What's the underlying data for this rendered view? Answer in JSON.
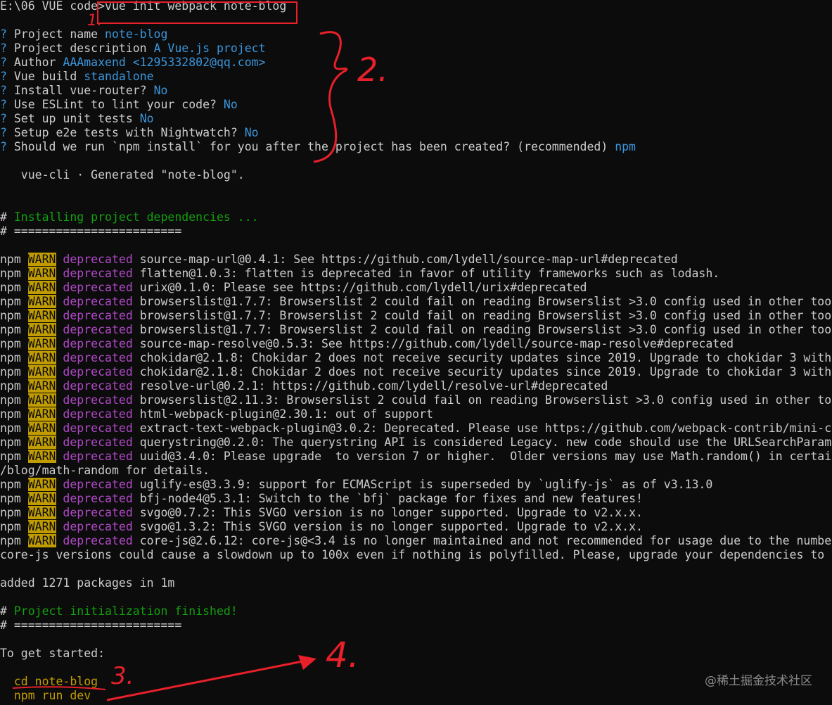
{
  "terminal": {
    "command_line": {
      "prompt": "E:\\06 VUE code>",
      "command": "vue init webpack note-blog"
    },
    "questions": [
      {
        "q": "Project name ",
        "a": "note-blog"
      },
      {
        "q": "Project description ",
        "a": "A Vue.js project"
      },
      {
        "q": "Author ",
        "a": "AAAmaxend <1295332802@qq.com>"
      },
      {
        "q": "Vue build ",
        "a": "standalone"
      },
      {
        "q": "Install vue-router? ",
        "a": "No"
      },
      {
        "q": "Use ESLint to lint your code? ",
        "a": "No"
      },
      {
        "q": "Set up unit tests ",
        "a": "No"
      },
      {
        "q": "Setup e2e tests with Nightwatch? ",
        "a": "No"
      },
      {
        "q": "Should we run `npm install` for you after the project has been created? (recommended) ",
        "a": "npm"
      }
    ],
    "question_mark": "?",
    "generated": "   vue-cli · Generated \"note-blog\".",
    "install_header": "# Installing project dependencies ...",
    "separator": "# ========================",
    "npm_label": "npm ",
    "warn_label": "WARN",
    "deprecated_label": " deprecated ",
    "warnings": [
      "source-map-url@0.4.1: See https://github.com/lydell/source-map-url#deprecated",
      "flatten@1.0.3: flatten is deprecated in favor of utility frameworks such as lodash.",
      "urix@0.1.0: Please see https://github.com/lydell/urix#deprecated",
      "browserslist@1.7.7: Browserslist 2 could fail on reading Browserslist >3.0 config used in other too",
      "browserslist@1.7.7: Browserslist 2 could fail on reading Browserslist >3.0 config used in other too",
      "browserslist@1.7.7: Browserslist 2 could fail on reading Browserslist >3.0 config used in other too",
      "source-map-resolve@0.5.3: See https://github.com/lydell/source-map-resolve#deprecated",
      "chokidar@2.1.8: Chokidar 2 does not receive security updates since 2019. Upgrade to chokidar 3 with",
      "chokidar@2.1.8: Chokidar 2 does not receive security updates since 2019. Upgrade to chokidar 3 with",
      "resolve-url@0.2.1: https://github.com/lydell/resolve-url#deprecated",
      "browserslist@2.11.3: Browserslist 2 could fail on reading Browserslist >3.0 config used in other to",
      "html-webpack-plugin@2.30.1: out of support",
      "extract-text-webpack-plugin@3.0.2: Deprecated. Please use https://github.com/webpack-contrib/mini-c",
      "querystring@0.2.0: The querystring API is considered Legacy. new code should use the URLSearchParam",
      "uuid@3.4.0: Please upgrade  to version 7 or higher.  Older versions may use Math.random() in certai"
    ],
    "uuid_continuation": "/blog/math-random for details.",
    "warnings2": [
      "uglify-es@3.3.9: support for ECMAScript is superseded by `uglify-js` as of v3.13.0",
      "bfj-node4@5.3.1: Switch to the `bfj` package for fixes and new features!",
      "svgo@0.7.2: This SVGO version is no longer supported. Upgrade to v2.x.x.",
      "svgo@1.3.2: This SVGO version is no longer supported. Upgrade to v2.x.x.",
      "core-js@2.6.12: core-js@<3.4 is no longer maintained and not recommended for usage due to the numbe"
    ],
    "corejs_continuation": "core-js versions could cause a slowdown up to 100x even if nothing is polyfilled. Please, upgrade your dependencies to",
    "added": "added 1271 packages in 1m",
    "finished_header": "# Project initialization finished!",
    "to_get_started": "To get started:",
    "cmd_cd": "  cd note-blog",
    "cmd_run": "  npm run dev"
  },
  "annotations": {
    "label_1": "1.",
    "label_2": "2.",
    "label_3": "3.",
    "label_4": "4.",
    "color": "#e8202a"
  },
  "watermark": "@稀土掘金技术社区"
}
